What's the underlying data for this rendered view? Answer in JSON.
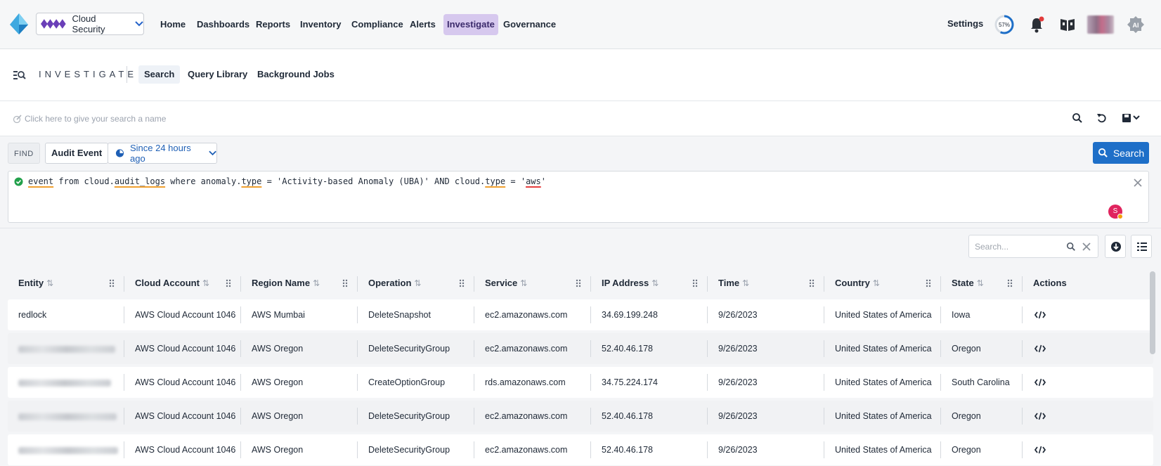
{
  "nav": {
    "product": "Cloud Security",
    "items": [
      "Home",
      "Dashboards",
      "Reports",
      "Inventory",
      "Compliance",
      "Alerts",
      "Investigate",
      "Governance"
    ],
    "active": "Investigate",
    "settings": "Settings",
    "progress_label": "57%",
    "progress_value": 57
  },
  "investigate": {
    "title": "INVESTIGATE",
    "tabs": [
      "Search",
      "Query Library",
      "Background Jobs"
    ],
    "active_tab": "Search"
  },
  "search_name": {
    "placeholder": "Click here to give your search a name"
  },
  "find": {
    "label": "FIND",
    "type": "Audit Event",
    "time_range": "Since 24 hours ago",
    "search_button": "Search"
  },
  "query": {
    "parts": [
      {
        "text": "event",
        "style": "o"
      },
      {
        "text": " from cloud.",
        "style": ""
      },
      {
        "text": "audit_logs",
        "style": "o"
      },
      {
        "text": " where anomaly.",
        "style": ""
      },
      {
        "text": "type",
        "style": "o"
      },
      {
        "text": " = 'Activity-based Anomaly (UBA)' AND cloud.",
        "style": ""
      },
      {
        "text": "type",
        "style": "o"
      },
      {
        "text": " = '",
        "style": ""
      },
      {
        "text": "aws",
        "style": "r"
      },
      {
        "text": "'",
        "style": ""
      }
    ],
    "user_badge": "S"
  },
  "table": {
    "search_placeholder": "Search...",
    "columns": [
      "Entity",
      "Cloud Account",
      "Region Name",
      "Operation",
      "Service",
      "IP Address",
      "Time",
      "Country",
      "State",
      "Actions"
    ],
    "rows": [
      {
        "entity": "redlock",
        "entity_blurred": false,
        "account": "AWS Cloud Account 1046",
        "region": "AWS Mumbai",
        "operation": "DeleteSnapshot",
        "service": "ec2.amazonaws.com",
        "ip": "34.69.199.248",
        "time": "9/26/2023",
        "country": "United States of America",
        "state": "Iowa"
      },
      {
        "entity": "",
        "entity_blurred": true,
        "account": "AWS Cloud Account 1046",
        "region": "AWS Oregon",
        "operation": "DeleteSecurityGroup",
        "service": "ec2.amazonaws.com",
        "ip": "52.40.46.178",
        "time": "9/26/2023",
        "country": "United States of America",
        "state": "Oregon"
      },
      {
        "entity": "",
        "entity_blurred": true,
        "account": "AWS Cloud Account 1046",
        "region": "AWS Oregon",
        "operation": "CreateOptionGroup",
        "service": "rds.amazonaws.com",
        "ip": "34.75.224.174",
        "time": "9/26/2023",
        "country": "United States of America",
        "state": "South Carolina"
      },
      {
        "entity": "",
        "entity_blurred": true,
        "account": "AWS Cloud Account 1046",
        "region": "AWS Oregon",
        "operation": "DeleteSecurityGroup",
        "service": "ec2.amazonaws.com",
        "ip": "52.40.46.178",
        "time": "9/26/2023",
        "country": "United States of America",
        "state": "Oregon"
      },
      {
        "entity": "",
        "entity_blurred": true,
        "account": "AWS Cloud Account 1046",
        "region": "AWS Oregon",
        "operation": "DeleteSecurityGroup",
        "service": "ec2.amazonaws.com",
        "ip": "52.40.46.178",
        "time": "9/26/2023",
        "country": "United States of America",
        "state": "Oregon"
      }
    ]
  },
  "colors": {
    "accent": "#1e6fc8",
    "nav_active": "#d6c8ee",
    "badge": "#e0245e"
  }
}
